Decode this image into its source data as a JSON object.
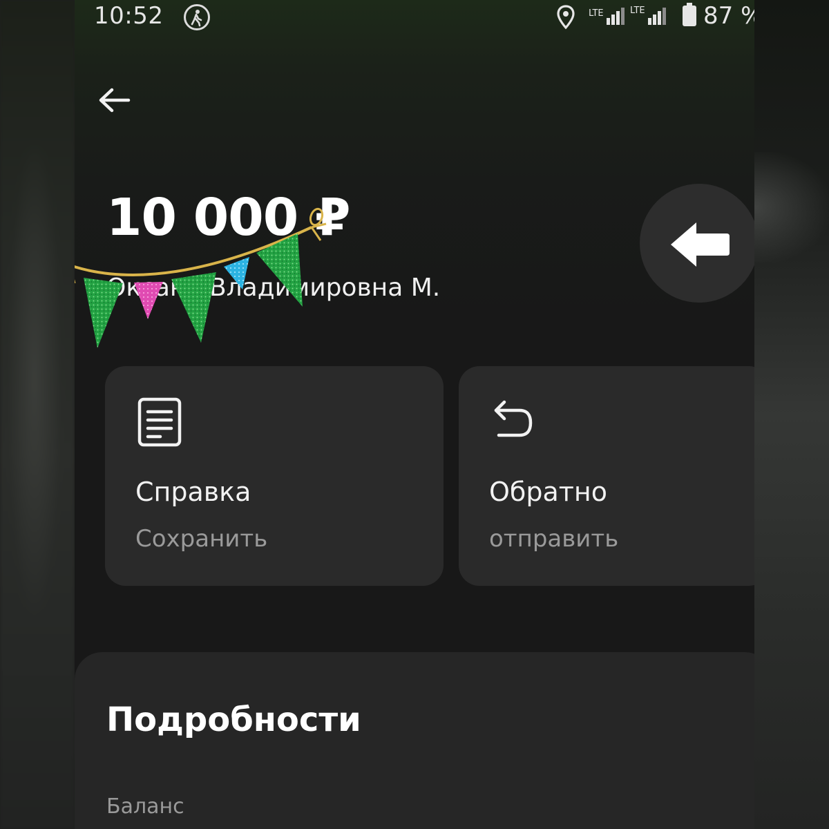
{
  "status_bar": {
    "time": "10:52",
    "network_1": "LTE",
    "network_2": "LTE",
    "battery": "87 %",
    "icons": [
      "walking-person-icon",
      "location-pin-icon",
      "signal-icon",
      "signal-icon",
      "battery-icon"
    ]
  },
  "header": {
    "back_icon": "arrow-left-icon"
  },
  "transfer": {
    "amount": "10 000 ₽",
    "recipient": "Оксана Владимировна М.",
    "direction_icon": "arrow-left-incoming-icon"
  },
  "actions": [
    {
      "icon": "document-icon",
      "title": "Справка",
      "subtitle": "Сохранить"
    },
    {
      "icon": "undo-arrow-icon",
      "title": "Обратно",
      "subtitle": "отправить"
    }
  ],
  "details": {
    "title": "Подробности",
    "balance_label": "Баланс"
  },
  "colors": {
    "background": "#181818",
    "card": "#2a2a2a",
    "secondary_text": "#9a9a9a",
    "garland_green": "#27a844",
    "garland_pink": "#e040b0",
    "garland_blue": "#2ab4e0",
    "garland_string": "#d9b44a"
  }
}
